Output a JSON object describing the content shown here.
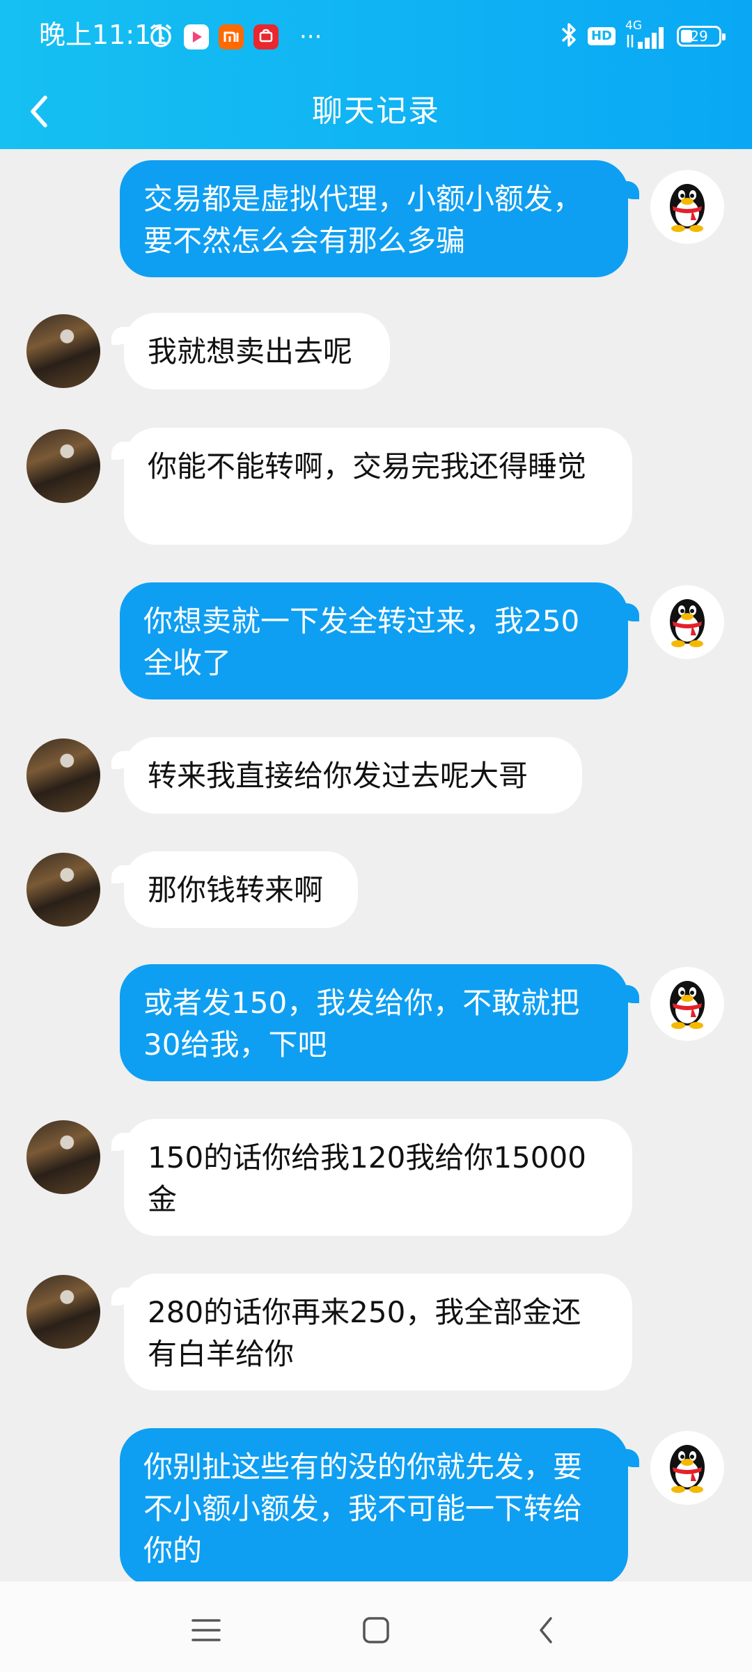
{
  "status_bar": {
    "time": "晚上11:11",
    "network": "4G",
    "hd": "HD",
    "battery": "29",
    "more": "···"
  },
  "header": {
    "title": "聊天记录"
  },
  "messages": [
    {
      "side": "out",
      "text": "交易都是虚拟代理，小额小额发，要不然怎么会有那么多骗"
    },
    {
      "side": "in",
      "text": "我就想卖出去呢"
    },
    {
      "side": "in",
      "text": "你能不能转啊，交易完我还得睡觉"
    },
    {
      "side": "out",
      "text": "你想卖就一下发全转过来，我250全收了"
    },
    {
      "side": "in",
      "text": "转来我直接给你发过去呢大哥"
    },
    {
      "side": "in",
      "text": "那你钱转来啊"
    },
    {
      "side": "out",
      "text": "或者发150，我发给你，不敢就把30给我，下吧"
    },
    {
      "side": "in",
      "text": "150的话你给我120我给你15000金"
    },
    {
      "side": "in",
      "text": "280的话你再来250，我全部金还有白羊给你"
    },
    {
      "side": "out",
      "text": "你别扯这些有的没的你就先发，要不小额小额发，我不可能一下转给你的"
    }
  ],
  "icons": {
    "back": "chevron-left-icon",
    "menu": "menu-icon",
    "home": "home-icon",
    "nav_back": "back-icon"
  },
  "colors": {
    "header": "#0fb6f3",
    "outgoing_bubble": "#0e9ff2",
    "incoming_bubble": "#ffffff",
    "background": "#efefef"
  }
}
